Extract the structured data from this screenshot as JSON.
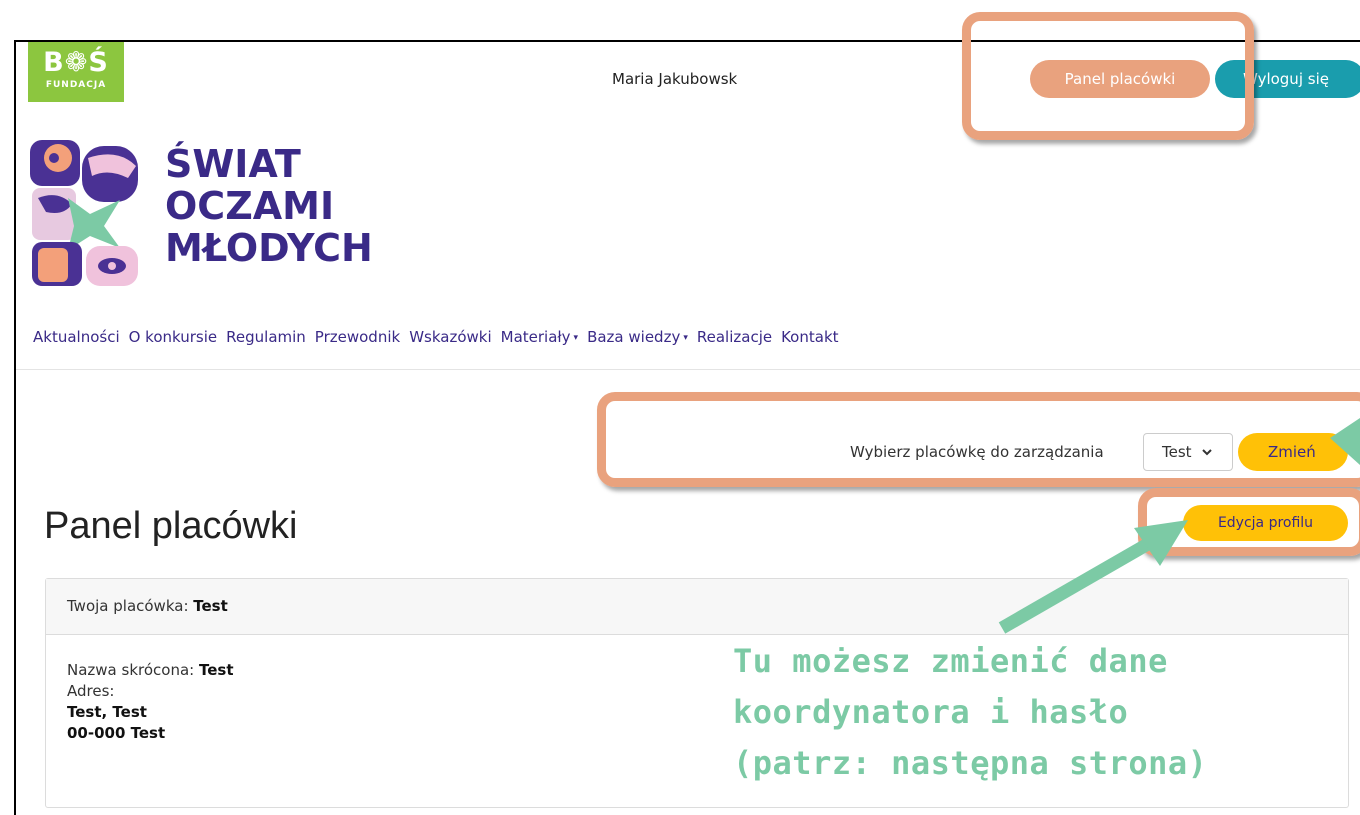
{
  "header": {
    "bos_logo": {
      "main": "B❁Ś",
      "sub": "FUNDACJA"
    },
    "user_name": "Maria Jakubowsk",
    "panel_button": "Panel placówki",
    "logout_button": "Wyloguj się"
  },
  "site": {
    "title_lines": [
      "ŚWIAT",
      "OCZAMI",
      "MŁODYCH"
    ]
  },
  "nav": {
    "items": [
      "Aktualności",
      "O konkursie",
      "Regulamin",
      "Przewodnik",
      "Wskazówki",
      "Materiały",
      "Baza wiedzy",
      "Realizacje",
      "Kontakt"
    ],
    "dropdown_caret": "▾"
  },
  "selector": {
    "label": "Wybierz placówkę do zarządzania",
    "selected": "Test",
    "button": "Zmień"
  },
  "page": {
    "title": "Panel placówki",
    "edit_button": "Edycja profilu"
  },
  "card": {
    "head_label": "Twoja placówka: ",
    "head_value": "Test",
    "short_name_label": "Nazwa skrócona: ",
    "short_name_value": "Test",
    "address_label": "Adres:",
    "address_line1": "Test, Test",
    "address_line2": "00-000 Test"
  },
  "annotation": {
    "lines": [
      "Tu możesz zmienić dane",
      "koordynatora i hasło",
      "(patrz: następna strona)"
    ],
    "highlight_color": "#e9a27e",
    "arrow_color": "#7ccaa5"
  }
}
